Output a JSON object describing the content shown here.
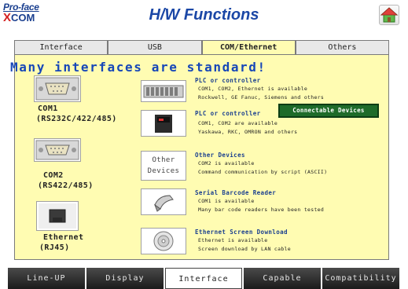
{
  "header": {
    "logo_line1": "Pro-face",
    "logo_line2_x": "X",
    "logo_line2_rest": "COM",
    "title": "H/W Functions"
  },
  "tabs": [
    {
      "label": "Interface",
      "active": false
    },
    {
      "label": "USB",
      "active": false
    },
    {
      "label": "COM/Ethernet",
      "active": true
    },
    {
      "label": "Others",
      "active": false
    }
  ],
  "main": {
    "headline": "Many interfaces are standard!",
    "ports": [
      {
        "label_line1": "COM1",
        "label_line2": "(RS232C/422/485)"
      },
      {
        "label_line1": "COM2",
        "label_line2": "(RS422/485)"
      },
      {
        "label_line1": "Ethernet",
        "label_line2": "(RJ45)"
      }
    ],
    "items": [
      {
        "title": "PLC or controller",
        "desc1": "COM1, COM2, Ethernet is available",
        "desc2": "Rockwell, GE Fanuc, Siemens and others"
      },
      {
        "title": "PLC or controller",
        "desc1": "COM1, COM2 are available",
        "desc2": "Yaskawa, RKC, OMRON and others"
      },
      {
        "title": "Other Devices",
        "desc1": "COM2 is available",
        "desc2": "Command communication by script (ASCII)"
      },
      {
        "title": "Serial Barcode Reader",
        "desc1": "COM1 is available",
        "desc2": "Many bar code readers have been tested"
      },
      {
        "title": "Ethernet Screen Download",
        "desc1": "Ethernet is available",
        "desc2": "Screen download by LAN cable"
      }
    ],
    "other_box_line1": "Other",
    "other_box_line2": "Devices",
    "connectable_button": "Connectable Devices"
  },
  "bottom_nav": [
    {
      "label": "Line-UP",
      "active": false
    },
    {
      "label": "Display",
      "active": false
    },
    {
      "label": "Interface",
      "active": true
    },
    {
      "label": "Capable",
      "active": false
    },
    {
      "label": "Compatibility",
      "active": false
    }
  ],
  "colors": {
    "panel_bg": "#fffcb2",
    "accent_blue": "#1747b8",
    "button_green": "#1e6b2a"
  }
}
